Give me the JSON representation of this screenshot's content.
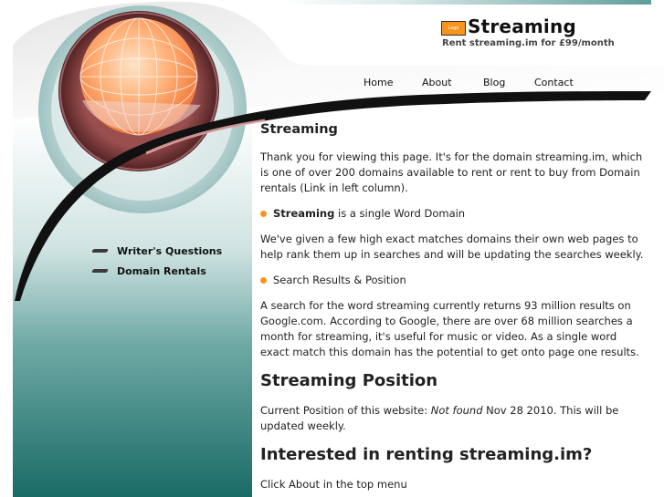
{
  "header": {
    "logo_text": "Logo",
    "site_title": "Streaming",
    "tagline": "Rent streaming.im for £99/month"
  },
  "nav": {
    "items": [
      {
        "label": "Home"
      },
      {
        "label": "About"
      },
      {
        "label": "Blog"
      },
      {
        "label": "Contact"
      }
    ]
  },
  "sidebar": {
    "items": [
      {
        "label": "Writer's Questions"
      },
      {
        "label": "Domain Rentals"
      }
    ]
  },
  "content": {
    "heading": "Streaming",
    "intro": "Thank you for viewing this page. It's for the domain streaming.im, which is one of over 200 domains available to rent or rent to buy from Domain rentals (Link in left column).",
    "bullet1_bold": "Streaming",
    "bullet1_rest": " is a single Word Domain",
    "para2": "We've given a few high exact matches domains their own web pages to help rank them up in searches and will be updating the searches weekly.",
    "bullet2": "Search Results & Position",
    "para3": "A search for the word streaming currently returns 93 million results on Google.com. According to Google, there are over 68 million searches a month for streaming, it's useful for music or video. As a single word exact match this domain has the potential to get onto page one results.",
    "position_heading": "Streaming Position",
    "position_prefix": "Current Position of this website: ",
    "position_value": "Not found",
    "position_suffix": " Nov 28 2010. This will be updated weekly.",
    "renting_heading": "Interested in renting streaming.im?",
    "renting_text": "Click About in the top menu"
  },
  "colors": {
    "accent_orange": "#f7941e",
    "teal_dark": "#1f6f6a",
    "teal_light": "#9fc8c6",
    "maroon": "#6e2b2b"
  }
}
